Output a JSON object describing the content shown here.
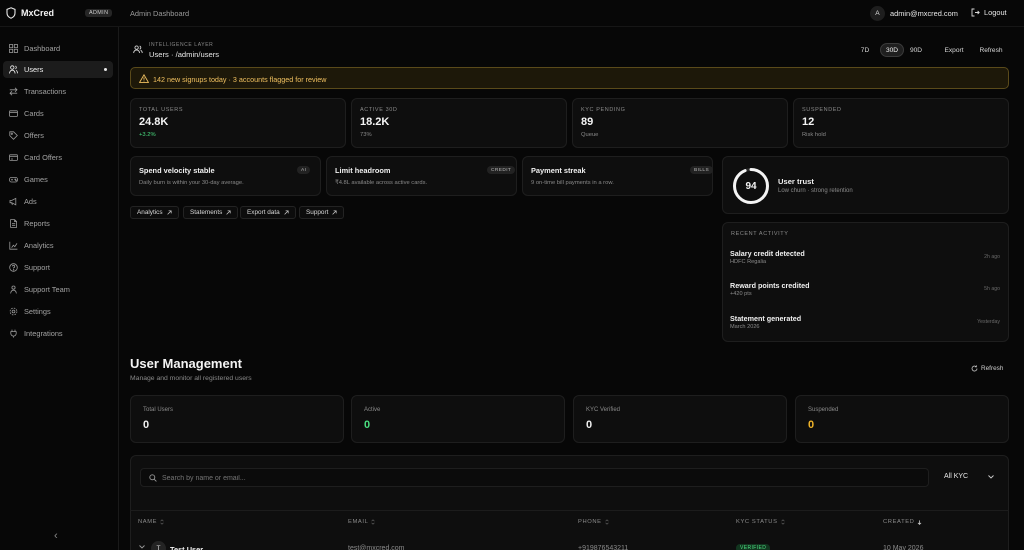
{
  "brand": {
    "name": "MxCred",
    "badge": "ADMIN"
  },
  "header": {
    "title": "Admin Dashboard",
    "avatar_initial": "A",
    "user_email": "admin@mxcred.com",
    "logout_label": "Logout"
  },
  "sidebar": {
    "items": [
      {
        "label": "Dashboard",
        "icon": "grid-icon"
      },
      {
        "label": "Users",
        "icon": "users-icon"
      },
      {
        "label": "Transactions",
        "icon": "arrows-icon"
      },
      {
        "label": "Cards",
        "icon": "card-icon"
      },
      {
        "label": "Offers",
        "icon": "tag-icon"
      },
      {
        "label": "Card Offers",
        "icon": "card-tag-icon"
      },
      {
        "label": "Games",
        "icon": "gamepad-icon"
      },
      {
        "label": "Ads",
        "icon": "megaphone-icon"
      },
      {
        "label": "Reports",
        "icon": "document-icon"
      },
      {
        "label": "Analytics",
        "icon": "chart-icon"
      },
      {
        "label": "Support",
        "icon": "help-icon"
      },
      {
        "label": "Support Team",
        "icon": "team-icon"
      },
      {
        "label": "Settings",
        "icon": "gear-icon"
      },
      {
        "label": "Integrations",
        "icon": "plug-icon"
      }
    ],
    "collapse_glyph": "‹"
  },
  "intel": {
    "eyebrow": "INTELLIGENCE LAYER",
    "path": "Users · /admin/users",
    "ranges": [
      "7D",
      "30D",
      "90D"
    ],
    "active_range": "30D",
    "export_label": "Export",
    "refresh_label": "Refresh"
  },
  "alert": {
    "text": "142 new signups today · 3 accounts flagged for review",
    "color": "#f0c060"
  },
  "stats": [
    {
      "label": "TOTAL USERS",
      "value": "24.8K",
      "sub": "+3.2%",
      "sub_color": "#4ade80"
    },
    {
      "label": "ACTIVE 30D",
      "value": "18.2K",
      "sub": "73%",
      "sub_color": "#8a8a8a"
    },
    {
      "label": "KYC PENDING",
      "value": "89",
      "sub": "Queue",
      "sub_color": "#8a8a8a"
    },
    {
      "label": "SUSPENDED",
      "value": "12",
      "sub": "Risk hold",
      "sub_color": "#8a8a8a"
    }
  ],
  "insights": [
    {
      "title": "Spend velocity stable",
      "badge": "AI",
      "desc": "Daily burn is within your 30-day average."
    },
    {
      "title": "Limit headroom",
      "badge": "CREDIT",
      "desc": "₹4.8L available across active cards."
    },
    {
      "title": "Payment streak",
      "badge": "BILLS",
      "desc": "9 on-time bill payments in a row."
    }
  ],
  "quick_links": [
    "Analytics",
    "Statements",
    "Export data",
    "Support"
  ],
  "trust": {
    "score": "94",
    "score_fraction": 0.94,
    "title": "User trust",
    "desc": "Low churn · strong retention"
  },
  "activity": {
    "heading": "RECENT ACTIVITY",
    "items": [
      {
        "title": "Salary credit detected",
        "sub": "HDFC Regalia",
        "time": "2h ago"
      },
      {
        "title": "Reward points credited",
        "sub": "+420 pts",
        "time": "5h ago"
      },
      {
        "title": "Statement generated",
        "sub": "March 2026",
        "time": "Yesterday"
      }
    ]
  },
  "user_mgmt": {
    "title": "User Management",
    "subtitle": "Manage and monitor all registered users",
    "refresh_label": "Refresh",
    "summary": [
      {
        "label": "Total Users",
        "value": "0",
        "color": "#f0f0f0"
      },
      {
        "label": "Active",
        "value": "0",
        "color": "#4ade80"
      },
      {
        "label": "KYC Verified",
        "value": "0",
        "color": "#f0f0f0"
      },
      {
        "label": "Suspended",
        "value": "0",
        "color": "#f0b429"
      }
    ],
    "search_placeholder": "Search by name or email...",
    "filter_value": "All KYC"
  },
  "table": {
    "columns": [
      "NAME",
      "EMAIL",
      "PHONE",
      "KYC STATUS",
      "CREATED"
    ],
    "rows": [
      {
        "initial": "T",
        "name": "Test User",
        "email": "test@mxcred.com",
        "phone": "+919876543211",
        "kyc": "VERIFIED",
        "created": "10 May 2026"
      }
    ]
  }
}
